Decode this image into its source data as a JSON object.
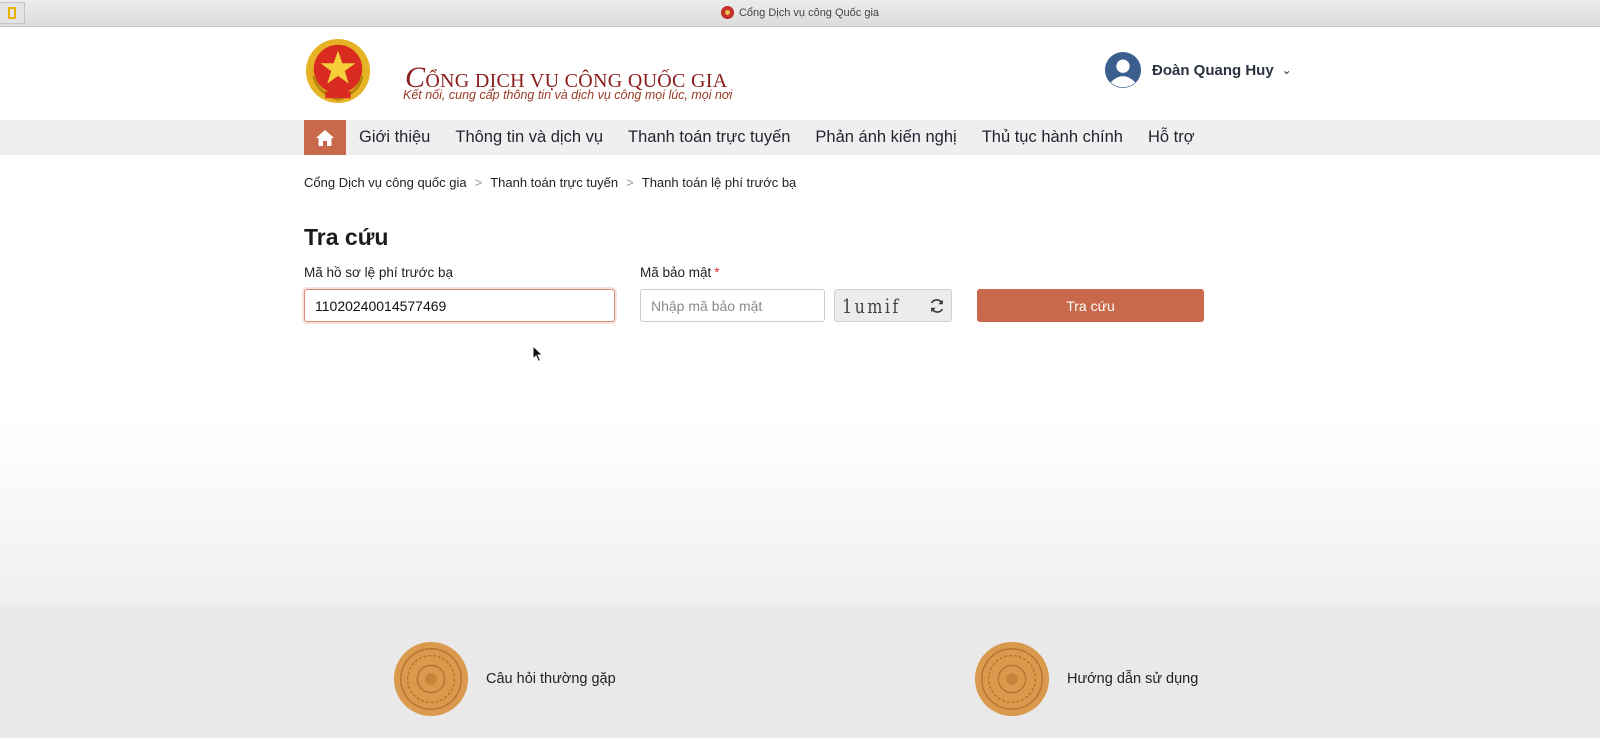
{
  "window": {
    "title": "Cổng Dịch vụ công Quốc gia"
  },
  "header": {
    "brand_initial": "C",
    "brand_rest": "ỔNG DỊCH VỤ CÔNG QUỐC GIA",
    "tagline": "Kết nối, cung cấp thông tin và dịch vụ công mọi lúc, mọi nơi",
    "user_name": "Đoàn Quang Huy"
  },
  "nav": {
    "items": [
      {
        "label": "Giới thiệu"
      },
      {
        "label": "Thông tin và dịch vụ"
      },
      {
        "label": "Thanh toán trực tuyến"
      },
      {
        "label": "Phản ánh kiến nghị"
      },
      {
        "label": "Thủ tục hành chính"
      },
      {
        "label": "Hỗ trợ"
      }
    ]
  },
  "breadcrumb": {
    "items": [
      {
        "label": "Cổng Dịch vụ công quốc gia"
      },
      {
        "label": "Thanh toán trực tuyến"
      },
      {
        "label": "Thanh toán lệ phí trước bạ"
      }
    ],
    "separator": ">"
  },
  "form": {
    "title": "Tra cứu",
    "record_label": "Mã hồ sơ lệ phí trước bạ",
    "record_value": "11020240014577469",
    "captcha_label": "Mã bảo mật",
    "required_mark": "*",
    "captcha_placeholder": "Nhập mã bảo mật",
    "captcha_image_text": "1umif",
    "submit_label": "Tra cứu"
  },
  "footer": {
    "faq_label": "Câu hỏi thường gặp",
    "guide_label": "Hướng dẫn sử dụng"
  },
  "colors": {
    "accent": "#c9694c",
    "brand_red": "#8b1c1c",
    "nav_bg": "#efefef",
    "footer_bg": "#e9e9e9"
  }
}
